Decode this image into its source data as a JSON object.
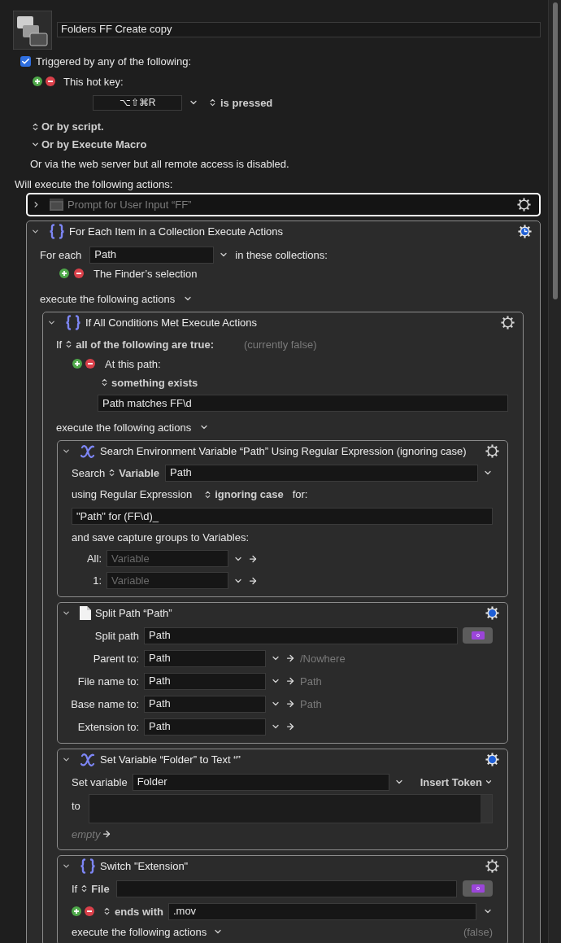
{
  "macro": {
    "title": "Folders FF Create copy"
  },
  "trigger": {
    "checked": true,
    "label": "Triggered by any of the following:"
  },
  "hot_key": {
    "label": "This hot key:",
    "keys": "⌥⇧⌘R",
    "condition": "is pressed"
  },
  "other_triggers": [
    {
      "kind": "stepper",
      "label": "Or by script."
    },
    {
      "kind": "disclosure",
      "label": "Or by Execute Macro"
    }
  ],
  "web_server_note": "Or via the web server but all remote access is disabled.",
  "actions_heading": "Will execute the following actions:",
  "actions": [
    {
      "kind": "prompt",
      "title": "Prompt for User Input “FF”",
      "expanded": false,
      "selected": true,
      "disabled": true,
      "highlighted": false,
      "timed": false
    },
    {
      "kind": "for_each",
      "title": "For Each Item in a Collection Execute Actions",
      "expanded": true,
      "selected": false,
      "disabled": false,
      "highlighted": true,
      "timed": true,
      "for_each_label": "For each",
      "variable": "Path",
      "collections_label": "in these collections:",
      "collections": [
        "The Finder’s selection"
      ],
      "execute_label": "execute the following actions",
      "children": [
        {
          "kind": "if_all",
          "title": "If All Conditions Met Execute Actions",
          "expanded": true,
          "selected": false,
          "disabled": false,
          "highlighted": false,
          "timed": false,
          "if_label": "If",
          "match": "all of the following are true:",
          "result": "(currently false)",
          "conditions": [
            {
              "label": "At this path:",
              "test": "something exists",
              "path": "Path matches FF\\d"
            }
          ],
          "execute_label": "execute the following actions",
          "children": [
            {
              "kind": "search_variable",
              "title": "Search Environment Variable “Path” Using Regular Expression (ignoring case)",
              "expanded": true,
              "selected": false,
              "disabled": false,
              "highlighted": false,
              "timed": false,
              "search_label": "Search",
              "source": "Variable",
              "variable": "Path",
              "using_label": "using Regular Expression",
              "case": "ignoring case",
              "for_label": "for:",
              "pattern": "\"Path\" for (FF\\d)_",
              "save_label": "and save capture groups to Variables:",
              "captures": [
                {
                  "label": "All:",
                  "placeholder": "Variable"
                },
                {
                  "label": "1:",
                  "placeholder": "Variable"
                }
              ]
            },
            {
              "kind": "split_path",
              "title": "Split Path “Path”",
              "expanded": true,
              "selected": false,
              "disabled": false,
              "highlighted": true,
              "timed": false,
              "split_label": "Split path",
              "path": "Path",
              "outputs": [
                {
                  "label": "Parent to:",
                  "value": "Path",
                  "preview": "/Nowhere"
                },
                {
                  "label": "File name to:",
                  "value": "Path",
                  "preview": "Path"
                },
                {
                  "label": "Base name to:",
                  "value": "Path",
                  "preview": "Path"
                },
                {
                  "label": "Extension to:",
                  "value": "Path"
                }
              ]
            },
            {
              "kind": "set_variable",
              "title": "Set Variable “Folder” to Text “”",
              "expanded": true,
              "selected": false,
              "disabled": false,
              "highlighted": true,
              "timed": false,
              "set_label": "Set variable",
              "variable": "Folder",
              "token_menu": "Insert Token",
              "to_label": "to",
              "result_hint": "empty"
            },
            {
              "kind": "switch",
              "title": "Switch \"Extension\"",
              "expanded": true,
              "selected": false,
              "disabled": false,
              "highlighted": false,
              "timed": false,
              "if_label": "If",
              "source": "File",
              "cases": [
                {
                  "test": "ends with",
                  "value": ".mov"
                }
              ],
              "execute_label": "execute the following actions",
              "result": "(false)"
            }
          ]
        }
      ]
    }
  ]
}
